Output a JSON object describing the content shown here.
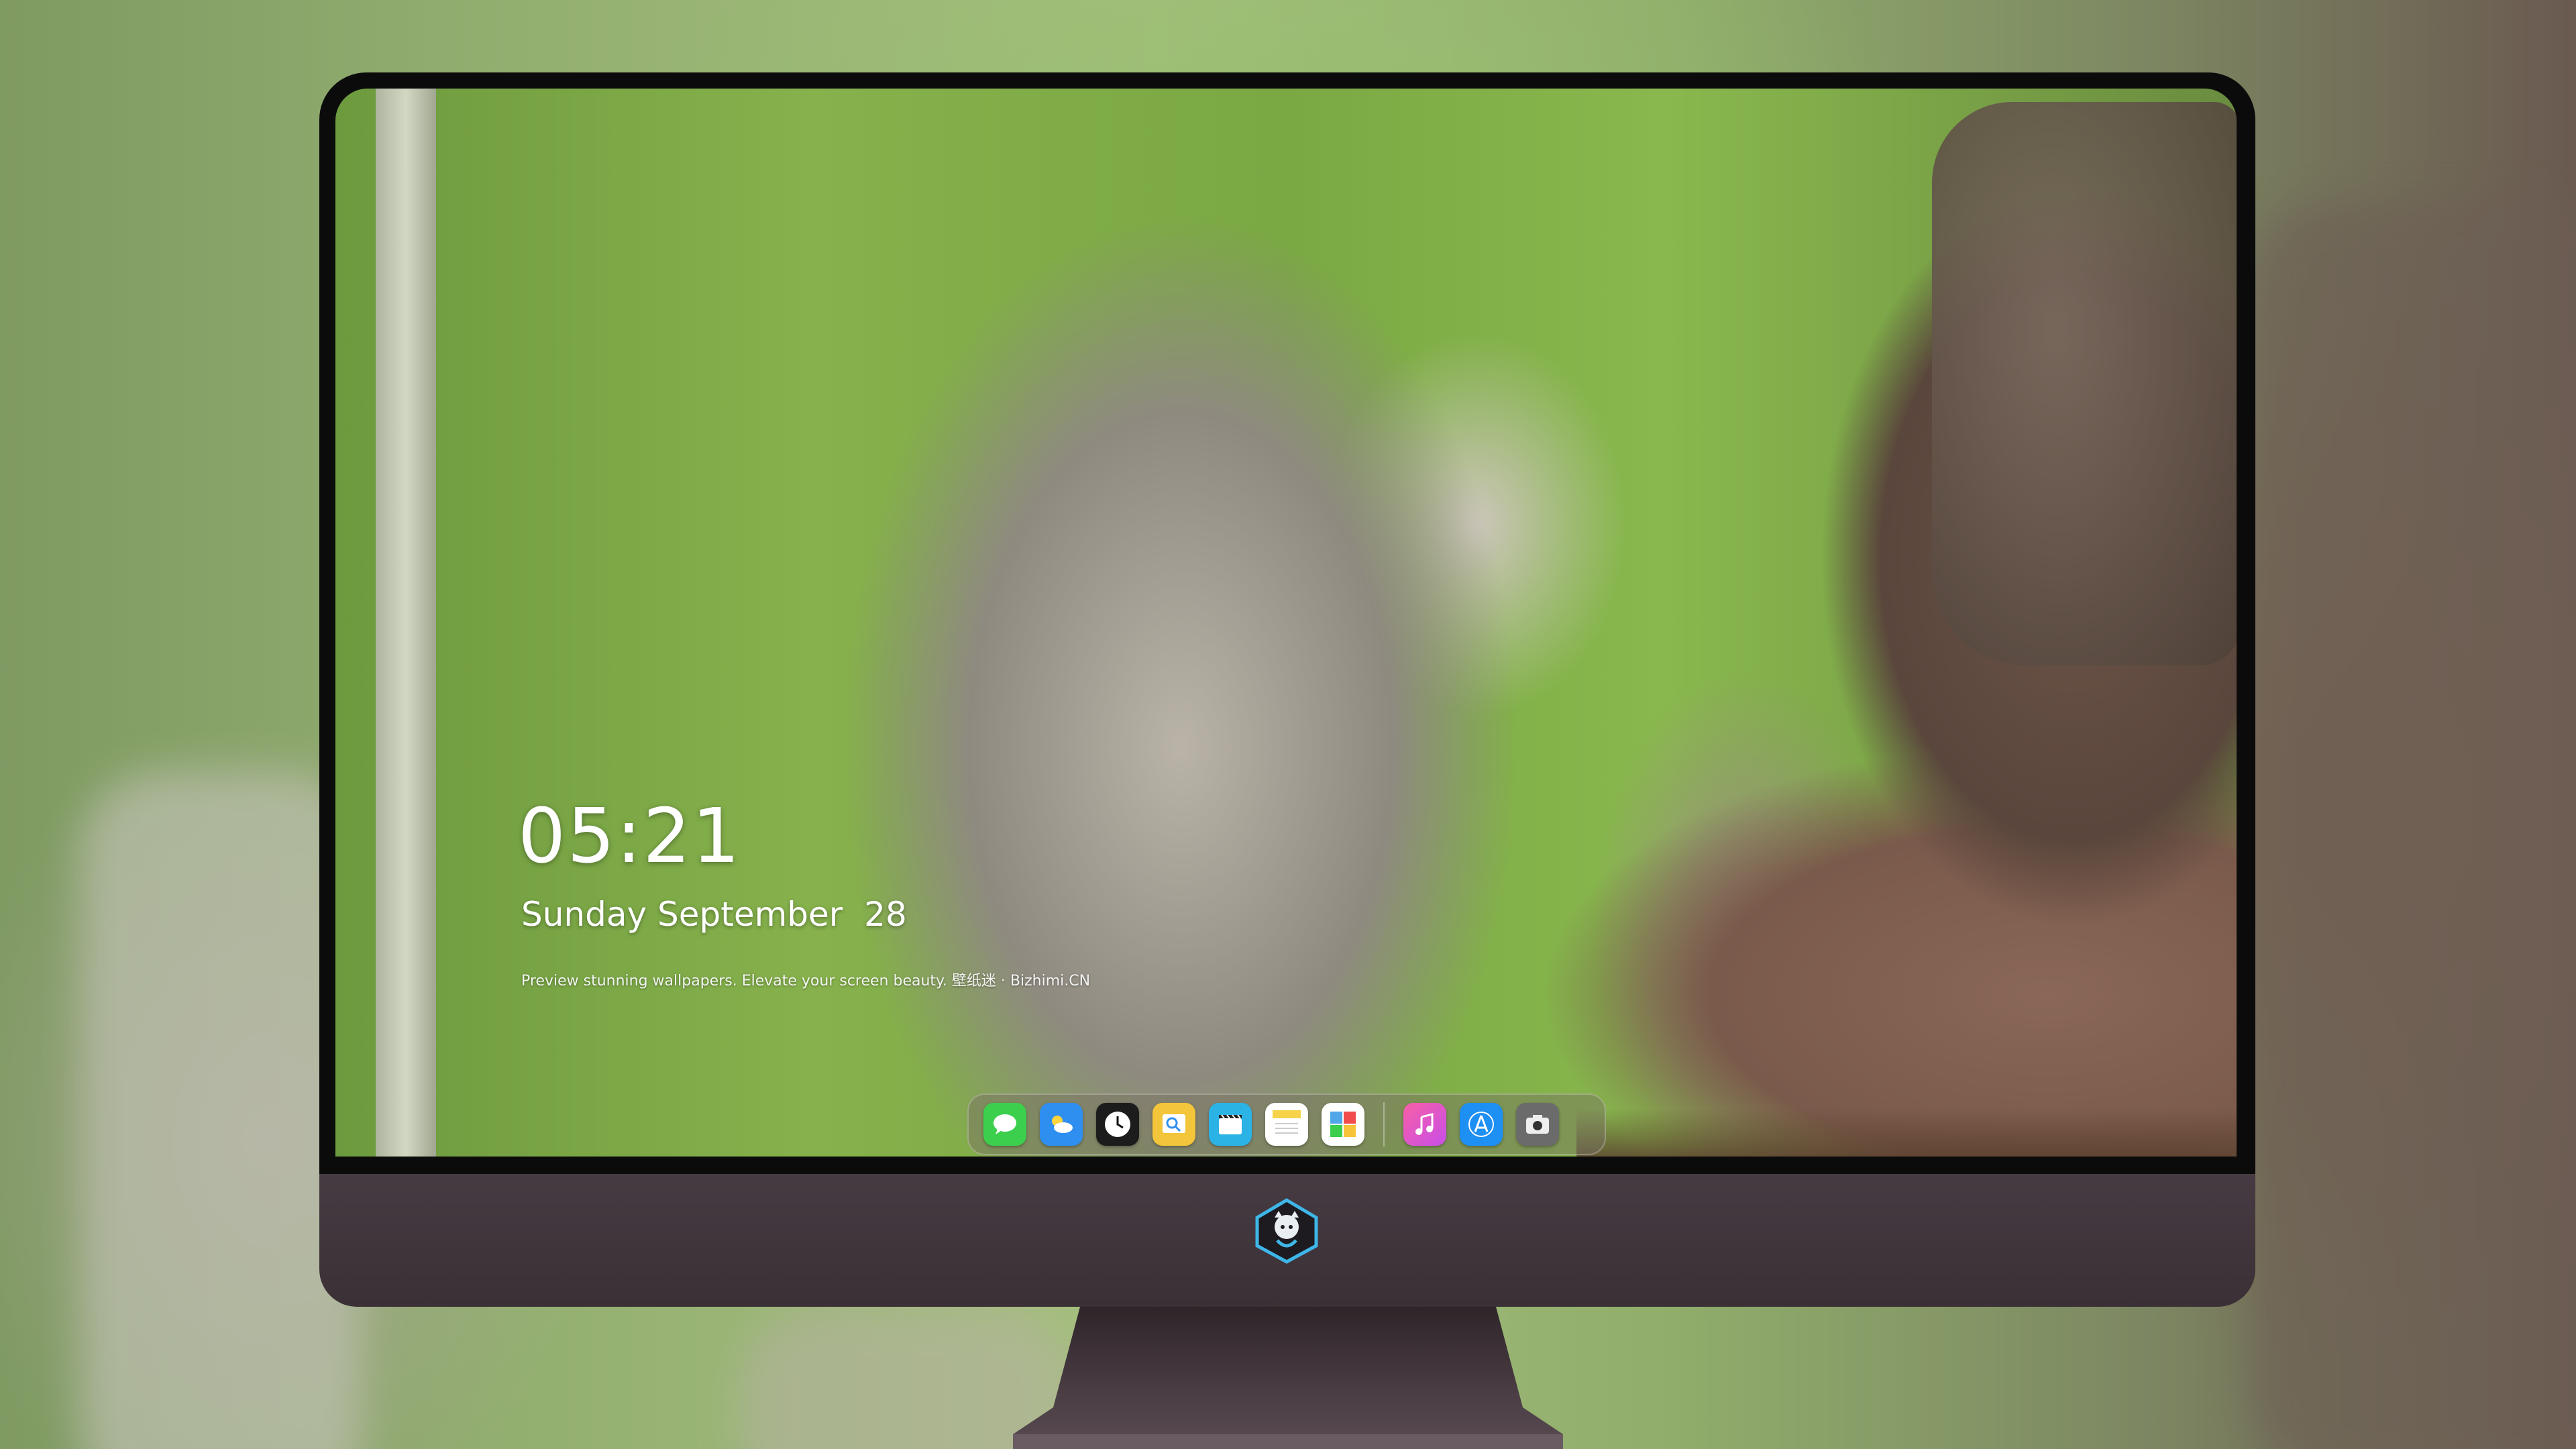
{
  "lockscreen": {
    "time": "05:21",
    "date": "Sunday September  28",
    "tagline": "Preview stunning wallpapers. Elevate your screen beauty. 壁纸迷 · Bizhimi.CN"
  },
  "dock": {
    "apps": [
      {
        "icon": "messages-icon",
        "color": "#3ccf4e"
      },
      {
        "icon": "weather-icon",
        "color": "#2f8ff0"
      },
      {
        "icon": "clock-icon",
        "color": "#1c1c1c"
      },
      {
        "icon": "preview-icon",
        "color": "#f3c53a"
      },
      {
        "icon": "clips-icon",
        "color": "#2bb3e6"
      },
      {
        "icon": "notes-icon",
        "color": "#f6d34a"
      },
      {
        "icon": "photo-booth-icon",
        "color": "#4fa7e8"
      },
      {
        "icon": "music-icon",
        "color": "#f24cb3"
      },
      {
        "icon": "app-store-icon",
        "color": "#1e8ff3"
      },
      {
        "icon": "camera-icon",
        "color": "#6b6b6b"
      }
    ]
  },
  "monitor": {
    "chin_logo": "monitor-logo-icon"
  }
}
